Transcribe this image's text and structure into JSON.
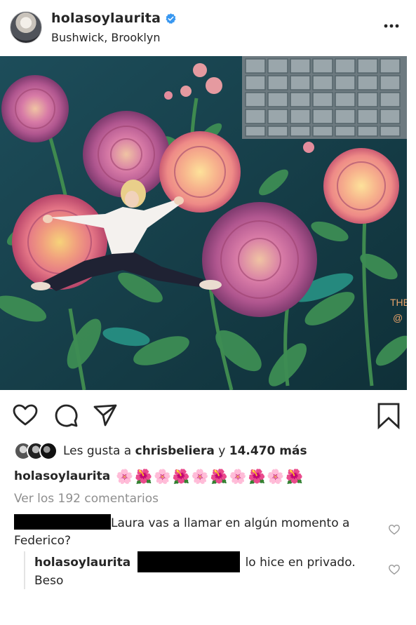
{
  "post": {
    "username": "holasoylaurita",
    "location": "Bushwick, Brooklyn",
    "verified": true
  },
  "photo": {
    "mural_signature_line1": "THE",
    "mural_signature_line2": "@"
  },
  "likes": {
    "prefix": "Les gusta a",
    "user": "chrisbeliera",
    "connector": "y",
    "count": "14.470 más"
  },
  "caption": {
    "username": "holasoylaurita",
    "emojis": "🌸🌺🌸🌺🌸🌺🌸🌺🌸🌺"
  },
  "comments": {
    "view_all": "Ver los 192 comentarios",
    "items": [
      {
        "text_line1": "Laura vas a llamar en algún momento a",
        "text_line2": "Federico?"
      }
    ],
    "reply": {
      "username": "holasoylaurita",
      "text_line1": "lo hice en privado.",
      "text_line2": "Beso"
    }
  },
  "icons": {
    "like": "heart-icon",
    "comment": "comment-icon",
    "share": "share-icon",
    "save": "bookmark-icon",
    "more": "more-icon"
  },
  "colors": {
    "verified_blue": "#3897f0",
    "muted_text": "#8e8e8e",
    "redaction": "#000000"
  }
}
